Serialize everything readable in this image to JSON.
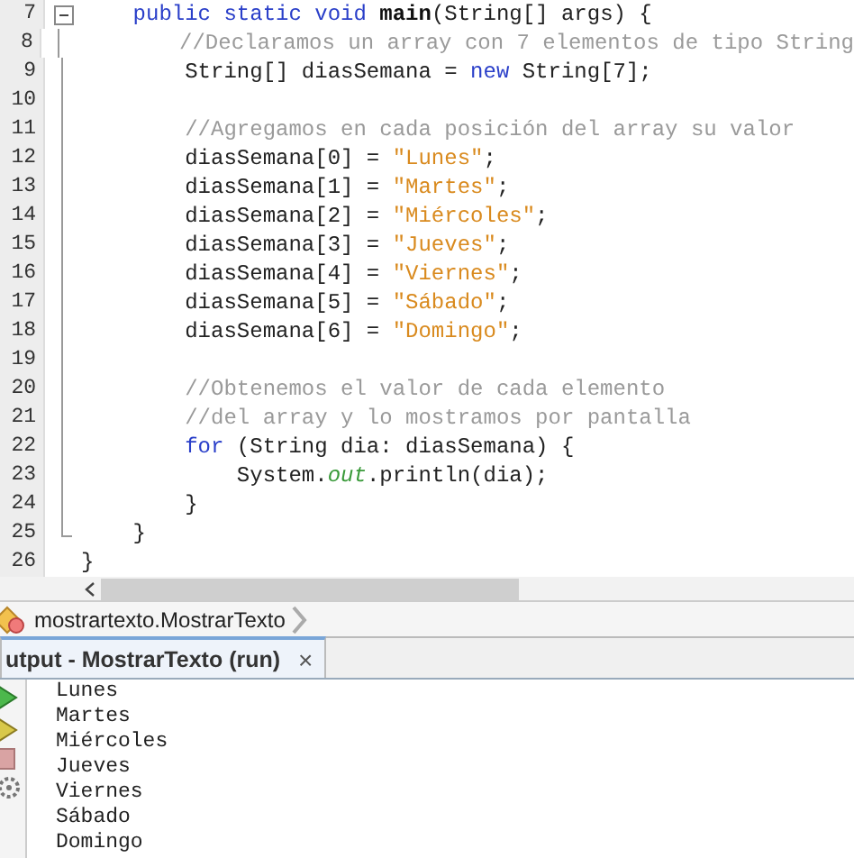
{
  "editor": {
    "lines": [
      {
        "number": "7",
        "fold_start": true,
        "in_fold": false,
        "fold_end": false,
        "tokens": [
          {
            "kind": "keyword",
            "text": "    public static void "
          },
          {
            "kind": "method",
            "text": "main"
          },
          {
            "kind": "plain",
            "text": "(String[] args) {"
          }
        ]
      },
      {
        "number": "8",
        "fold_start": false,
        "in_fold": true,
        "fold_end": false,
        "tokens": [
          {
            "kind": "comment",
            "text": "        //Declaramos un array con 7 elementos de tipo String"
          }
        ]
      },
      {
        "number": "9",
        "fold_start": false,
        "in_fold": true,
        "fold_end": false,
        "tokens": [
          {
            "kind": "plain",
            "text": "        String[] diasSemana = "
          },
          {
            "kind": "keyword",
            "text": "new"
          },
          {
            "kind": "plain",
            "text": " String[7];"
          }
        ]
      },
      {
        "number": "10",
        "fold_start": false,
        "in_fold": true,
        "fold_end": false
      },
      {
        "number": "11",
        "fold_start": false,
        "in_fold": true,
        "fold_end": false,
        "tokens": [
          {
            "kind": "comment",
            "text": "        //Agregamos en cada posición del array su valor"
          }
        ]
      },
      {
        "number": "12",
        "fold_start": false,
        "in_fold": true,
        "fold_end": false,
        "tokens": [
          {
            "kind": "plain",
            "text": "        diasSemana[0] = "
          },
          {
            "kind": "string",
            "text": "\"Lunes\""
          },
          {
            "kind": "plain",
            "text": ";"
          }
        ]
      },
      {
        "number": "13",
        "fold_start": false,
        "in_fold": true,
        "fold_end": false,
        "tokens": [
          {
            "kind": "plain",
            "text": "        diasSemana[1] = "
          },
          {
            "kind": "string",
            "text": "\"Martes\""
          },
          {
            "kind": "plain",
            "text": ";"
          }
        ]
      },
      {
        "number": "14",
        "fold_start": false,
        "in_fold": true,
        "fold_end": false,
        "tokens": [
          {
            "kind": "plain",
            "text": "        diasSemana[2] = "
          },
          {
            "kind": "string",
            "text": "\"Miércoles\""
          },
          {
            "kind": "plain",
            "text": ";"
          }
        ]
      },
      {
        "number": "15",
        "fold_start": false,
        "in_fold": true,
        "fold_end": false,
        "tokens": [
          {
            "kind": "plain",
            "text": "        diasSemana[3] = "
          },
          {
            "kind": "string",
            "text": "\"Jueves\""
          },
          {
            "kind": "plain",
            "text": ";"
          }
        ]
      },
      {
        "number": "16",
        "fold_start": false,
        "in_fold": true,
        "fold_end": false,
        "tokens": [
          {
            "kind": "plain",
            "text": "        diasSemana[4] = "
          },
          {
            "kind": "string",
            "text": "\"Viernes\""
          },
          {
            "kind": "plain",
            "text": ";"
          }
        ]
      },
      {
        "number": "17",
        "fold_start": false,
        "in_fold": true,
        "fold_end": false,
        "tokens": [
          {
            "kind": "plain",
            "text": "        diasSemana[5] = "
          },
          {
            "kind": "string",
            "text": "\"Sábado\""
          },
          {
            "kind": "plain",
            "text": ";"
          }
        ]
      },
      {
        "number": "18",
        "fold_start": false,
        "in_fold": true,
        "fold_end": false,
        "tokens": [
          {
            "kind": "plain",
            "text": "        diasSemana[6] = "
          },
          {
            "kind": "string",
            "text": "\"Domingo\""
          },
          {
            "kind": "plain",
            "text": ";"
          }
        ]
      },
      {
        "number": "19",
        "fold_start": false,
        "in_fold": true,
        "fold_end": false
      },
      {
        "number": "20",
        "fold_start": false,
        "in_fold": true,
        "fold_end": false,
        "tokens": [
          {
            "kind": "comment",
            "text": "        //Obtenemos el valor de cada elemento"
          }
        ]
      },
      {
        "number": "21",
        "fold_start": false,
        "in_fold": true,
        "fold_end": false,
        "tokens": [
          {
            "kind": "comment",
            "text": "        //del array y lo mostramos por pantalla"
          }
        ]
      },
      {
        "number": "22",
        "fold_start": false,
        "in_fold": true,
        "fold_end": false,
        "tokens": [
          {
            "kind": "keyword",
            "text": "        for"
          },
          {
            "kind": "plain",
            "text": " (String dia: diasSemana) {"
          }
        ]
      },
      {
        "number": "23",
        "fold_start": false,
        "in_fold": true,
        "fold_end": false,
        "tokens": [
          {
            "kind": "plain",
            "text": "            System."
          },
          {
            "kind": "field",
            "text": "out"
          },
          {
            "kind": "plain",
            "text": ".println(dia);"
          }
        ]
      },
      {
        "number": "24",
        "fold_start": false,
        "in_fold": true,
        "fold_end": false,
        "tokens": [
          {
            "kind": "plain",
            "text": "        }"
          }
        ]
      },
      {
        "number": "25",
        "fold_start": false,
        "in_fold": false,
        "fold_end": true,
        "tokens": [
          {
            "kind": "plain",
            "text": "    }"
          }
        ]
      },
      {
        "number": "26",
        "fold_start": false,
        "in_fold": false,
        "fold_end": false,
        "tokens": [
          {
            "kind": "plain",
            "text": "}"
          }
        ]
      }
    ]
  },
  "breadcrumb": {
    "path": "mostrartexto.MostrarTexto"
  },
  "output": {
    "tab": {
      "title": "utput - MostrarTexto (run)",
      "close": "×",
      "selected": true
    },
    "lines": [
      "Lunes",
      "Martes",
      "Miércoles",
      "Jueves",
      "Viernes",
      "Sábado",
      "Domingo"
    ]
  }
}
